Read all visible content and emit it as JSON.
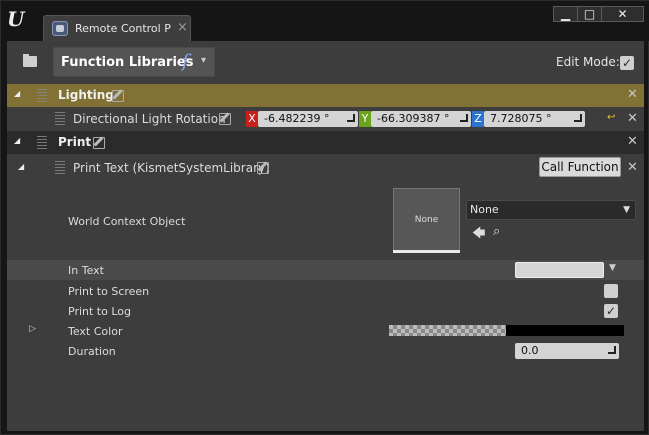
{
  "window": {
    "tab_title": "Remote Control P",
    "tab_close": "×",
    "controls": {
      "minimize": "▁",
      "maximize": "□",
      "close": "✕"
    }
  },
  "toolbar": {
    "function_libraries_label": "Function Libraries",
    "function_symbol": "f",
    "chevron": "▾",
    "edit_mode_label": "Edit Mode:",
    "edit_mode_checked": true
  },
  "lighting": {
    "label": "Lighting",
    "property": {
      "label": "Directional Light Rotation",
      "x_axis": "X",
      "x_value": "-6.482239 °",
      "y_axis": "Y",
      "y_value": "-66.309387 °",
      "z_axis": "Z",
      "z_value": "7.728075 °"
    }
  },
  "print": {
    "label": "Print",
    "function": {
      "label": "Print Text (KismetSystemLibrary)",
      "call_button": "Call Function"
    }
  },
  "params": {
    "world_context_label": "World Context Object",
    "thumbnail_text": "None",
    "world_context_value": "None",
    "in_text_label": "In Text",
    "print_screen_label": "Print to Screen",
    "print_screen_checked": false,
    "print_log_label": "Print to Log",
    "print_log_checked": true,
    "text_color_label": "Text Color",
    "duration_label": "Duration",
    "duration_value": "0.0"
  },
  "colors": {
    "lighting_bg": "#817134",
    "axis_x": "#c8201a",
    "axis_y": "#6aa31e",
    "axis_z": "#2b72d1",
    "text_color_swatch": "#000000"
  },
  "icons": [
    "ue-logo",
    "remote-control-icon",
    "folder-icon",
    "grip-icon",
    "pencil-icon",
    "close-icon",
    "reset-arrow-icon",
    "back-arrow-icon",
    "search-icon",
    "chevron-down-icon",
    "expand-triangle-icon"
  ]
}
